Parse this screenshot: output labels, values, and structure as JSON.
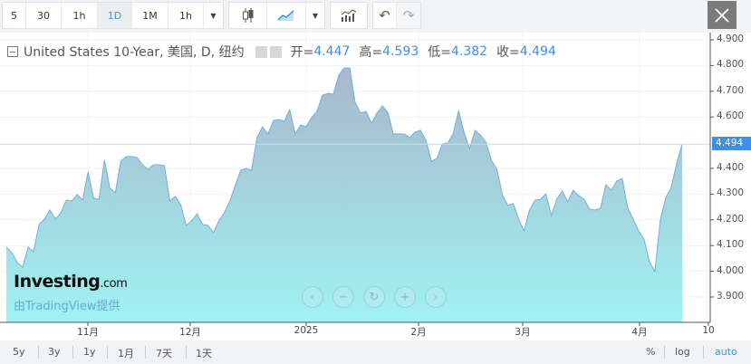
{
  "toolbar": {
    "intervals": [
      "5",
      "30",
      "1h",
      "1D",
      "1M",
      "1h"
    ],
    "active_interval": "1D",
    "icons": [
      "chevron-down-icon",
      "candlestick-icon",
      "area-chart-icon",
      "chevron-down-icon",
      "indicators-icon",
      "undo-icon",
      "redo-icon",
      "close-icon"
    ]
  },
  "legend": {
    "title": "United States 10-Year, 美国, D, 纽约",
    "open_label": "开=",
    "open": "4.447",
    "high_label": "高=",
    "high": "4.593",
    "low_label": "低=",
    "low": "4.382",
    "close_label": "收=",
    "close": "4.494"
  },
  "watermark": {
    "brand": "Investing",
    "brand_suffix": ".com",
    "provider": "由TradingView提供"
  },
  "nav_buttons": [
    "‹",
    "−",
    "↻",
    "+",
    "›"
  ],
  "bottom_bar": {
    "ranges": [
      "5y",
      "3y",
      "1y",
      "1月",
      "7天",
      "1天"
    ],
    "percent": "%",
    "log": "log",
    "auto": "auto"
  },
  "colors": {
    "accent": "#3d8fe8",
    "line": "#6fb0e0",
    "fill_top": "#a9b7cb",
    "fill_bottom": "#9ff2f2"
  },
  "chart_data": {
    "type": "area",
    "y_ticks": [
      "4.900",
      "4.800",
      "4.700",
      "4.600",
      "4.400",
      "4.300",
      "4.200",
      "4.100",
      "4.000",
      "3.900"
    ],
    "x_ticks": [
      "11月",
      "12月",
      "2025",
      "2月",
      "3月",
      "4月",
      "10"
    ],
    "ylim": [
      3.82,
      4.92
    ],
    "last_value_label": "4.494",
    "values": [
      4.094,
      4.073,
      4.034,
      4.016,
      4.094,
      4.076,
      4.182,
      4.203,
      4.238,
      4.203,
      4.227,
      4.277,
      4.273,
      4.298,
      4.277,
      4.386,
      4.284,
      4.28,
      4.432,
      4.323,
      4.305,
      4.428,
      4.446,
      4.446,
      4.442,
      4.414,
      4.396,
      4.414,
      4.414,
      4.411,
      4.273,
      4.291,
      4.259,
      4.178,
      4.196,
      4.224,
      4.182,
      4.178,
      4.15,
      4.196,
      4.227,
      4.273,
      4.333,
      4.393,
      4.4,
      4.393,
      4.52,
      4.562,
      4.534,
      4.587,
      4.59,
      4.583,
      4.629,
      4.534,
      4.569,
      4.562,
      4.597,
      4.622,
      4.685,
      4.692,
      4.689,
      4.763,
      4.791,
      4.791,
      4.657,
      4.615,
      4.622,
      4.576,
      4.615,
      4.643,
      4.618,
      4.534,
      4.534,
      4.534,
      4.52,
      4.541,
      4.548,
      4.509,
      4.428,
      4.439,
      4.495,
      4.499,
      4.537,
      4.625,
      4.537,
      4.477,
      4.548,
      4.53,
      4.502,
      4.432,
      4.396,
      4.298,
      4.256,
      4.263,
      4.203,
      4.157,
      4.238,
      4.277,
      4.28,
      4.301,
      4.217,
      4.28,
      4.312,
      4.27,
      4.315,
      4.294,
      4.28,
      4.242,
      4.238,
      4.245,
      4.337,
      4.315,
      4.351,
      4.361,
      4.249,
      4.203,
      4.157,
      4.125,
      4.037,
      3.999,
      4.199,
      4.287,
      4.326,
      4.421,
      4.494
    ]
  }
}
